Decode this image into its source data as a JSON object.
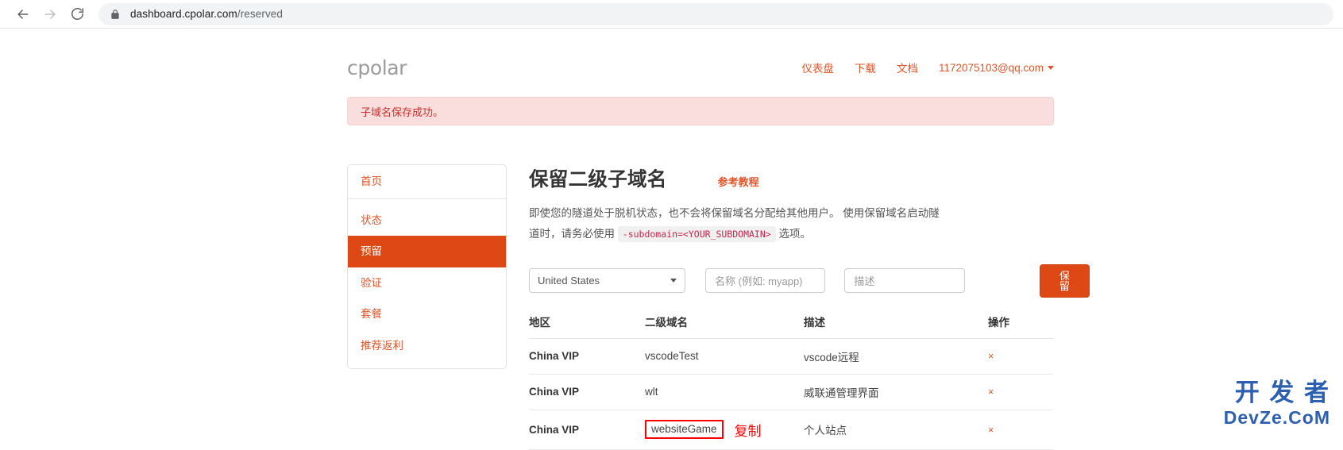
{
  "browser": {
    "back_icon": "arrow-left-icon",
    "forward_icon": "arrow-right-icon",
    "reload_icon": "reload-icon",
    "lock_icon": "lock-icon",
    "url_host": "dashboard.cpolar.com",
    "url_path": "/reserved"
  },
  "header": {
    "logo": "cpolar",
    "nav": [
      {
        "label": "仪表盘"
      },
      {
        "label": "下载"
      },
      {
        "label": "文档"
      },
      {
        "label": "1172075103@qq.com",
        "has_caret": true
      }
    ]
  },
  "alert": {
    "message": "子域名保存成功。",
    "bg_color": "#f9dedd",
    "text_color": "#c9302c"
  },
  "sidebar": {
    "items": [
      {
        "label": "首页",
        "active": false
      },
      {
        "label": "状态",
        "active": false
      },
      {
        "label": "预留",
        "active": true
      },
      {
        "label": "验证",
        "active": false
      },
      {
        "label": "套餐",
        "active": false
      },
      {
        "label": "推荐返利",
        "active": false
      }
    ],
    "accent_color": "#dd4814",
    "link_color": "#e0562a"
  },
  "main": {
    "title": "保留二级子域名",
    "tutorial_link": "参考教程",
    "description_part1": "即使您的隧道处于脱机状态，也不会将保留域名分配给其他用户。 使用保留域名启动隧道时，请务必使用",
    "description_code": "-subdomain=<YOUR_SUBDOMAIN>",
    "description_part2": "选项。",
    "form": {
      "region_value": "United States",
      "name_placeholder": "名称 (例如: myapp)",
      "desc_placeholder": "描述",
      "save_label": "保留"
    },
    "table": {
      "columns": [
        "地区",
        "二级域名",
        "描述",
        "操作"
      ],
      "rows": [
        {
          "region": "China VIP",
          "subdomain": "vscodeTest",
          "description": "vscode远程",
          "action": "×",
          "highlighted": false
        },
        {
          "region": "China VIP",
          "subdomain": "wlt",
          "description": "威联通管理界面",
          "action": "×",
          "highlighted": false
        },
        {
          "region": "China VIP",
          "subdomain": "websiteGame",
          "description": "个人站点",
          "action": "×",
          "highlighted": true,
          "annotation": "复制"
        }
      ]
    }
  },
  "watermark": {
    "line1": "开 发 者",
    "line2": "DevZe.CoM",
    "color": "#2d5fb0"
  }
}
